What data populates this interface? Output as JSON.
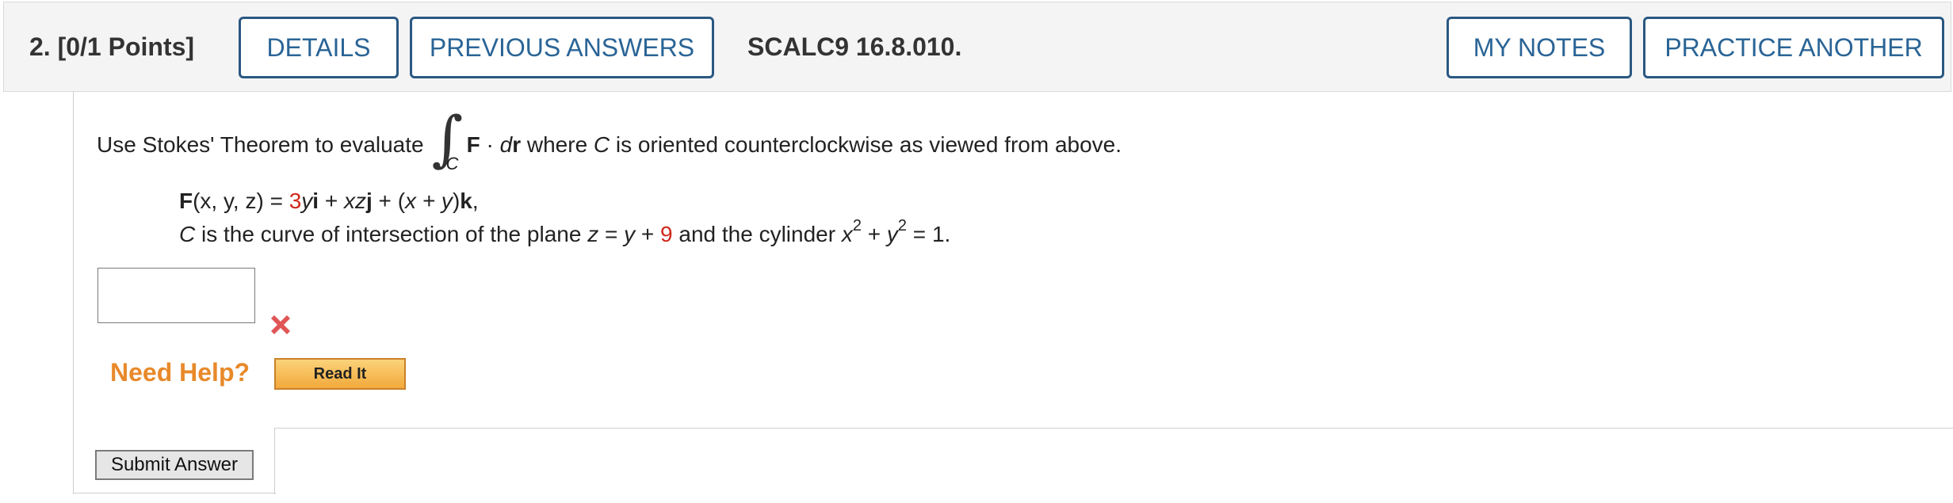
{
  "header": {
    "question_label": "2.  [0/1 Points]",
    "details_label": "DETAILS",
    "previous_answers_label": "PREVIOUS ANSWERS",
    "question_id": "SCALC9 16.8.010.",
    "my_notes_label": "MY NOTES",
    "practice_another_label": "PRACTICE ANOTHER"
  },
  "problem": {
    "intro_before": "Use Stokes' Theorem to evaluate",
    "integral_sub": "C",
    "integrand_F": "F",
    "dot": " · ",
    "d": "d",
    "r": "r",
    "intro_after": " where ",
    "curve_C": "C",
    "intro_end": " is oriented counterclockwise as viewed from above.",
    "field": {
      "F": "F",
      "args": "(x, y, z) = ",
      "coef1": "3",
      "y": "y",
      "i": "i",
      "plus1": " + ",
      "xz": "xz",
      "j": "j",
      "plus2": " + (",
      "xy": "x + y",
      "close": ")",
      "k": "k",
      "comma": ","
    },
    "curve": {
      "C": "C",
      "text1": " is the curve of intersection of the plane ",
      "z": "z",
      "eq": " = ",
      "y": "y",
      "plus": " + ",
      "const": "9",
      "text2": " and the cylinder ",
      "x": "x",
      "exp1": "2",
      "plus2": " + ",
      "y2": "y",
      "exp2": "2",
      "end": " = 1."
    }
  },
  "answer": {
    "value": "",
    "status_icon": "x-mark-icon",
    "status_color": "#e05555"
  },
  "help": {
    "label": "Need Help?",
    "read_it_label": "Read It"
  },
  "submit_label": "Submit Answer",
  "colors": {
    "accent": "#2a5882",
    "red_value": "#d0281c",
    "help_orange": "#e8892a"
  }
}
